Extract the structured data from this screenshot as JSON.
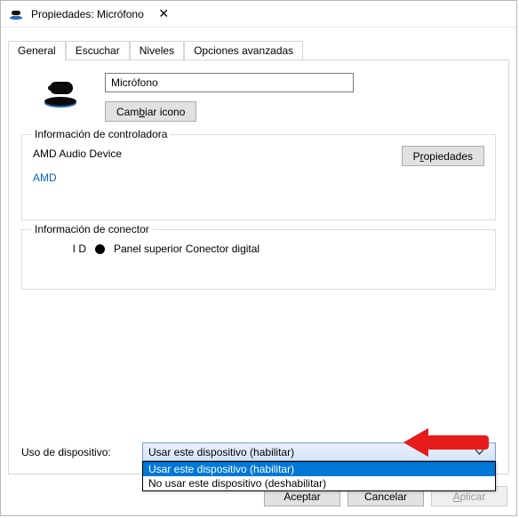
{
  "titlebar": {
    "title": "Propiedades: Micrófono"
  },
  "tabs": {
    "general": "General",
    "escuchar": "Escuchar",
    "niveles": "Niveles",
    "opciones": "Opciones avanzadas"
  },
  "device": {
    "name": "Micrófono",
    "change_icon": "Cambiar icono",
    "change_icon_u": "b"
  },
  "controller": {
    "legend": "Información de controladora",
    "name": "AMD Audio Device",
    "vendor": "AMD",
    "properties": "Propiedades",
    "properties_u": "r"
  },
  "connector": {
    "legend": "Información de conector",
    "id_label": "I D",
    "text": "Panel superior Conector digital"
  },
  "usage": {
    "label": "Uso de dispositivo:",
    "selected": "Usar este dispositivo (habilitar)",
    "options": [
      "Usar este dispositivo (habilitar)",
      "No usar este dispositivo (deshabilitar)"
    ]
  },
  "footer": {
    "ok": "Aceptar",
    "cancel": "Cancelar",
    "apply": "Aplicar",
    "apply_u": "A"
  }
}
